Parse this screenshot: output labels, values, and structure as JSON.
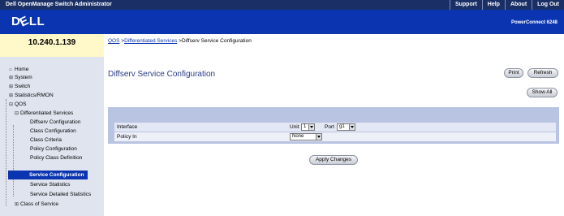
{
  "topbar": {
    "title": "Dell OpenManage Switch Administrator",
    "links": [
      "Support",
      "Help",
      "About",
      "Log Out"
    ]
  },
  "brand": {
    "logo": "DELL",
    "product": "PowerConnect 6248"
  },
  "sidebar": {
    "ip": "10.240.1.139",
    "items": [
      {
        "label": "Home",
        "icon": "home-icon"
      },
      {
        "label": "System",
        "icon": "expand-icon"
      },
      {
        "label": "Switch",
        "icon": "expand-icon"
      },
      {
        "label": "Statistics/RMON",
        "icon": "expand-icon"
      },
      {
        "label": "QOS",
        "icon": "collapse-icon"
      },
      {
        "label": "Differentiated Services",
        "icon": "collapse-icon"
      },
      {
        "label": "Diffserv Configuration"
      },
      {
        "label": "Class Configuration"
      },
      {
        "label": "Class Criteria"
      },
      {
        "label": "Policy Configuration"
      },
      {
        "label": "Policy Class Definition"
      },
      {
        "label": "Service Configuration",
        "selected": true
      },
      {
        "label": "Service Statistics"
      },
      {
        "label": "Service Detailed Statistics"
      },
      {
        "label": "Class of Service",
        "icon": "expand-icon"
      }
    ]
  },
  "breadcrumb": {
    "items": [
      "QOS",
      "Differentiated Services",
      "Diffserv Service Configuration"
    ],
    "separator": ">"
  },
  "page": {
    "title": "Diffserv Service Configuration",
    "print": "Print",
    "refresh": "Refresh",
    "show_all": "Show All",
    "apply": "Apply Changes"
  },
  "form": {
    "interface_label": "Interface",
    "unit_label": "Unit",
    "unit_value": "1",
    "port_label": "Port",
    "port_value": "g1",
    "policy_label": "Policy In",
    "policy_value": "None"
  },
  "colors": {
    "topbar": "#1a2f66",
    "brand": "#0a34b0",
    "sidebar": "#dfe4ef",
    "panel": "#b9c3e2"
  }
}
